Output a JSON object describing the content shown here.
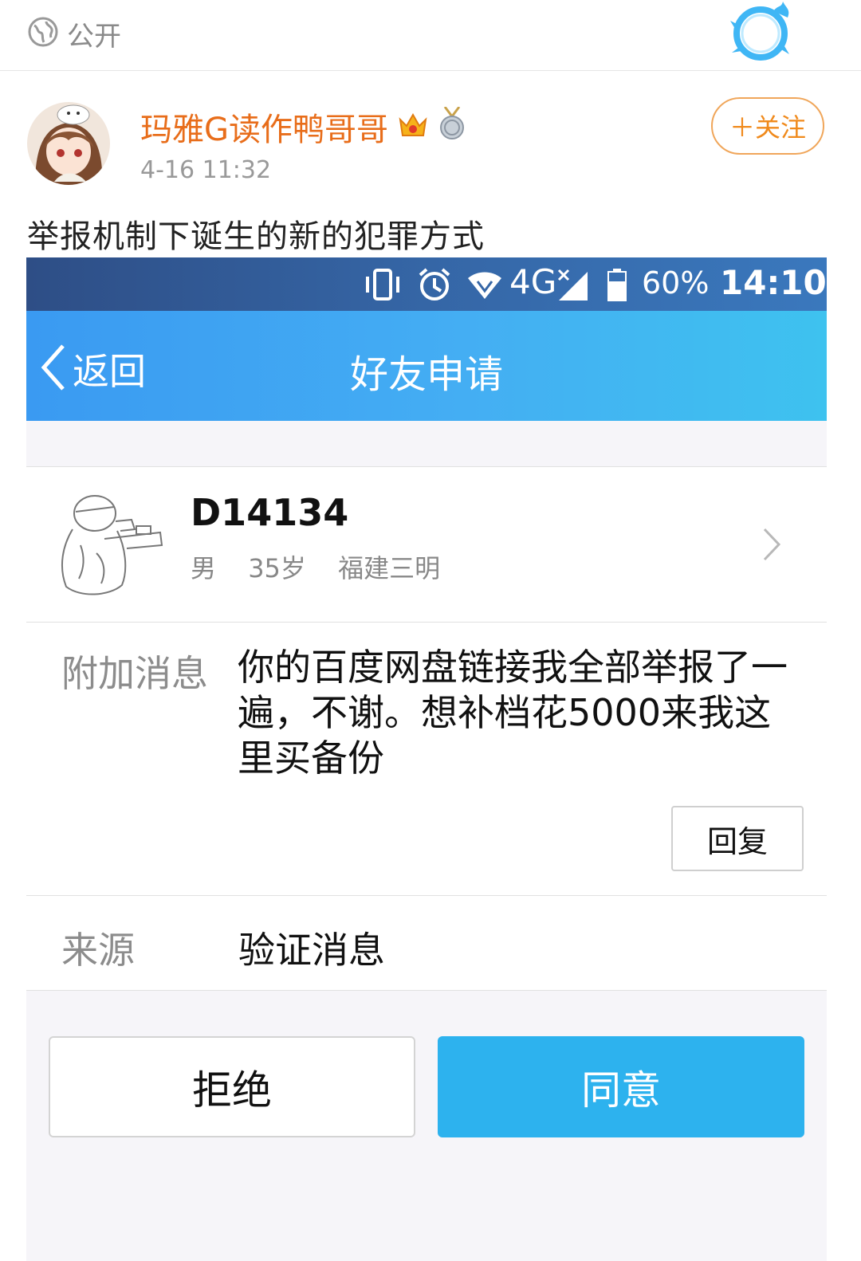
{
  "post": {
    "visibility": "公开",
    "author": "玛雅G读作鸭哥哥",
    "time": "4-16 11:32",
    "follow_label": "＋关注",
    "text": "举报机制下诞生的新的犯罪方式"
  },
  "screenshot": {
    "status_bar": {
      "network": "4G",
      "battery": "60%",
      "time": "14:10"
    },
    "nav": {
      "back_label": "返回",
      "title": "好友申请"
    },
    "profile": {
      "name": "D14134",
      "gender": "男",
      "age": "35岁",
      "location": "福建三明"
    },
    "message": {
      "label": "附加消息",
      "body": "你的百度网盘链接我全部举报了一遍，不谢。想补档花5000来我这里买备份",
      "reply_label": "回复"
    },
    "source": {
      "label": "来源",
      "value": "验证消息"
    },
    "actions": {
      "reject_label": "拒绝",
      "accept_label": "同意"
    }
  },
  "colors": {
    "username": "#e86d1a",
    "nav_blue": "#44aef3",
    "accept_blue": "#2db2ee",
    "status_bar": "#3566a6"
  },
  "icons": [
    "globe-icon",
    "fire-ring-icon",
    "crown-badge-icon",
    "medal-badge-icon",
    "back-chevron-icon",
    "vibrate-icon",
    "alarm-icon",
    "wifi-icon",
    "signal-icon",
    "battery-icon",
    "chevron-right-icon"
  ]
}
